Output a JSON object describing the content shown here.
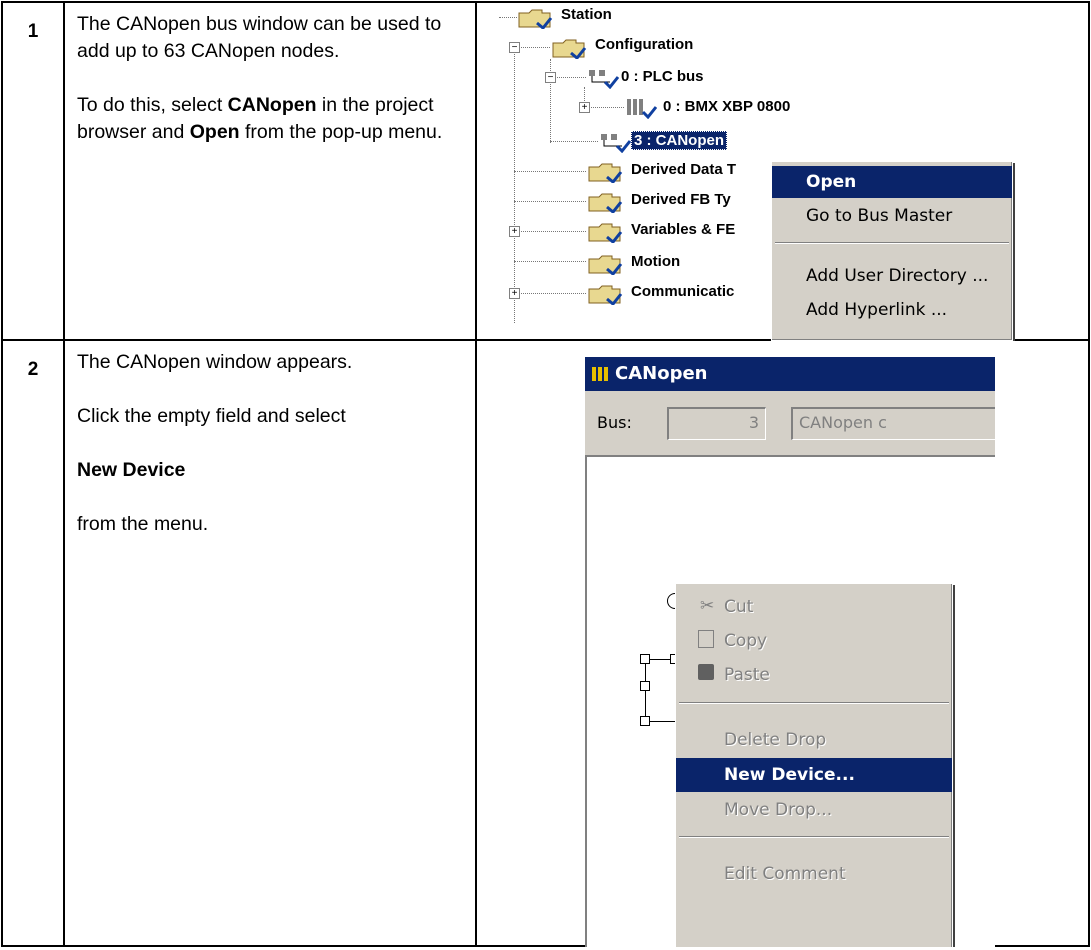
{
  "steps": [
    {
      "number": "1",
      "text_a": "The CANopen bus window can be used to add up to 63 CANopen nodes.",
      "text_b_pre": "To do this, select ",
      "text_b_bold1": "CANopen",
      "text_b_mid": " in the project browser and ",
      "text_b_bold2": "Open",
      "text_b_post": " from the pop-up menu."
    },
    {
      "number": "2",
      "text_a": "The CANopen window appears.",
      "text_b": "Click the empty field and select",
      "text_c": "New Device",
      "text_d": "from the menu."
    }
  ],
  "browser": {
    "station": "Station",
    "configuration": "Configuration",
    "plc_bus": "0 : PLC bus",
    "rack": "0 : BMX XBP 0800",
    "canopen": "3 : CANopen",
    "derived_data": "Derived Data T",
    "derived_fb": "Derived FB Ty",
    "variables": "Variables & FE",
    "motion": "Motion",
    "communication": "Communicatic"
  },
  "browser_menu": {
    "items": [
      "Open",
      "Go to Bus Master",
      "Add User Directory ...",
      "Add Hyperlink ..."
    ]
  },
  "canopen_window": {
    "title": "CANopen",
    "bus_label": "Bus:",
    "bus_number": "3",
    "bus_name": "CANopen c"
  },
  "context_menu": {
    "items": [
      "Cut",
      "Copy",
      "Paste",
      "Delete Drop",
      "New Device...",
      "Move Drop...",
      "Edit Comment"
    ]
  },
  "colors": {
    "selection": "#0a246a",
    "menu_bg": "#d4d0c8",
    "folder": "#e8d890"
  }
}
